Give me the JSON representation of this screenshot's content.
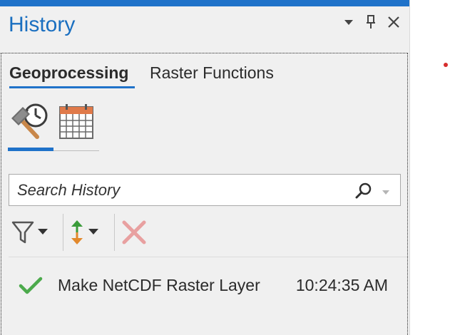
{
  "pane": {
    "title": "History",
    "accent_color": "#1f72c9",
    "menu_icon": "dropdown-triangle-icon",
    "pin_icon": "pin-icon",
    "close_icon": "close-icon"
  },
  "tabs": [
    {
      "label": "Geoprocessing",
      "active": true
    },
    {
      "label": "Raster Functions",
      "active": false
    }
  ],
  "views": [
    {
      "icon": "tool-history-icon",
      "active": true
    },
    {
      "icon": "calendar-icon",
      "active": false
    }
  ],
  "search": {
    "placeholder": "Search History",
    "value": "",
    "icon": "search-icon",
    "dropdown_icon": "chevron-down-icon"
  },
  "toolbar": {
    "filter_icon": "filter-icon",
    "sort_icon": "sort-icon",
    "delete_icon": "delete-icon",
    "sort_up_color": "#3a9b3a",
    "sort_down_color": "#e2892c",
    "delete_color": "#e8a0a0"
  },
  "history_items": [
    {
      "status": "success",
      "status_icon": "checkmark-icon",
      "name": "Make NetCDF Raster Layer",
      "time": "10:24:35 AM"
    }
  ],
  "colors": {
    "success": "#4caa4c",
    "red_dot": "#d62d2d"
  }
}
